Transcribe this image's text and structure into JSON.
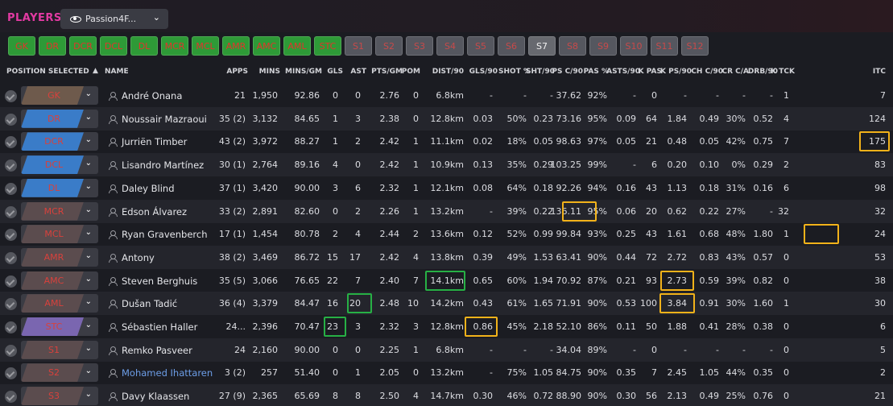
{
  "header": {
    "title": "PLAYERS",
    "view_label": "Passion4F..."
  },
  "positions": [
    {
      "label": "GK",
      "state": "on",
      "w": 34
    },
    {
      "label": "DR",
      "state": "on",
      "w": 34
    },
    {
      "label": "DCR",
      "state": "on",
      "w": 34
    },
    {
      "label": "DCL",
      "state": "on",
      "w": 34
    },
    {
      "label": "DL",
      "state": "on",
      "w": 34
    },
    {
      "label": "MCR",
      "state": "on",
      "w": 34
    },
    {
      "label": "MCL",
      "state": "on",
      "w": 34
    },
    {
      "label": "AMR",
      "state": "on",
      "w": 34
    },
    {
      "label": "AMC",
      "state": "on",
      "w": 34
    },
    {
      "label": "AML",
      "state": "on",
      "w": 34
    },
    {
      "label": "STC",
      "state": "on",
      "w": 34
    },
    {
      "label": "S1",
      "state": "off",
      "w": 34
    },
    {
      "label": "S2",
      "state": "off",
      "w": 34
    },
    {
      "label": "S3",
      "state": "off",
      "w": 34
    },
    {
      "label": "S4",
      "state": "off",
      "w": 34
    },
    {
      "label": "S5",
      "state": "off",
      "w": 34
    },
    {
      "label": "S6",
      "state": "off",
      "w": 34
    },
    {
      "label": "S7",
      "state": "sel",
      "w": 34
    },
    {
      "label": "S8",
      "state": "off",
      "w": 34
    },
    {
      "label": "S9",
      "state": "off",
      "w": 34
    },
    {
      "label": "S10",
      "state": "off",
      "w": 34
    },
    {
      "label": "S11",
      "state": "off",
      "w": 34
    },
    {
      "label": "S12",
      "state": "off",
      "w": 34
    }
  ],
  "columns": [
    "POSITION SELECTED",
    "NAME",
    "APPS",
    "MINS",
    "MINS/GM",
    "GLS",
    "AST",
    "PTS/GM",
    "POM",
    "DIST/90",
    "GLS/90",
    "SHOT %",
    "SHT/90",
    "PS C/90",
    "PAS %",
    "ASTS/90",
    "K PAS",
    "K PS/90",
    "CH C/90",
    "CR C/A",
    "DRB/90",
    "K TCK",
    "ITC"
  ],
  "sort_indicator": "▲",
  "players": [
    {
      "pos": "GK",
      "pos_color": "#6e5a4c",
      "name": "André Onana",
      "link": false,
      "v": [
        "21",
        "1,950",
        "92.86",
        "0",
        "0",
        "2.76",
        "0",
        "6.8km",
        "-",
        "-",
        "-",
        "37.62",
        "92%",
        "-",
        "0",
        "-",
        "-",
        "-",
        "-",
        "1",
        "7"
      ]
    },
    {
      "pos": "DR",
      "pos_color": "#3a7cc8",
      "name": "Noussair Mazraoui",
      "link": false,
      "v": [
        "35 (2)",
        "3,132",
        "84.65",
        "1",
        "3",
        "2.38",
        "0",
        "12.8km",
        "0.03",
        "50%",
        "0.23",
        "73.16",
        "95%",
        "0.09",
        "64",
        "1.84",
        "0.49",
        "30%",
        "0.52",
        "4",
        "124"
      ]
    },
    {
      "pos": "DCR",
      "pos_color": "#3a7cc8",
      "name": "Jurriën Timber",
      "link": false,
      "v": [
        "43 (2)",
        "3,972",
        "88.27",
        "1",
        "2",
        "2.42",
        "1",
        "11.1km",
        "0.02",
        "18%",
        "0.05",
        "98.63",
        "97%",
        "0.05",
        "21",
        "0.48",
        "0.05",
        "42%",
        "0.75",
        "7",
        "175"
      ]
    },
    {
      "pos": "DCL",
      "pos_color": "#3a7cc8",
      "name": "Lisandro Martínez",
      "link": false,
      "v": [
        "30 (1)",
        "2,764",
        "89.16",
        "4",
        "0",
        "2.42",
        "1",
        "10.9km",
        "0.13",
        "35%",
        "0.29",
        "103.25",
        "99%",
        "-",
        "6",
        "0.20",
        "0.10",
        "0%",
        "0.29",
        "2",
        "83"
      ]
    },
    {
      "pos": "DL",
      "pos_color": "#3a7cc8",
      "name": "Daley Blind",
      "link": false,
      "v": [
        "37 (1)",
        "3,420",
        "90.00",
        "3",
        "6",
        "2.32",
        "1",
        "12.1km",
        "0.08",
        "64%",
        "0.18",
        "92.26",
        "94%",
        "0.16",
        "43",
        "1.13",
        "0.18",
        "31%",
        "0.16",
        "6",
        "98"
      ]
    },
    {
      "pos": "MCR",
      "pos_color": "#5b4c4e",
      "name": "Edson Álvarez",
      "link": false,
      "v": [
        "33 (2)",
        "2,891",
        "82.60",
        "0",
        "2",
        "2.26",
        "1",
        "13.2km",
        "-",
        "39%",
        "0.22",
        "136.11",
        "95%",
        "0.06",
        "20",
        "0.62",
        "0.22",
        "27%",
        "-",
        "32",
        "32"
      ]
    },
    {
      "pos": "MCL",
      "pos_color": "#5b4c4e",
      "name": "Ryan Gravenberch",
      "link": false,
      "v": [
        "17 (1)",
        "1,454",
        "80.78",
        "2",
        "4",
        "2.44",
        "2",
        "13.6km",
        "0.12",
        "52%",
        "0.99",
        "99.84",
        "93%",
        "0.25",
        "43",
        "1.61",
        "0.68",
        "48%",
        "1.80",
        "1",
        "24"
      ]
    },
    {
      "pos": "AMR",
      "pos_color": "#5b4c4e",
      "name": "Antony",
      "link": false,
      "v": [
        "38 (2)",
        "3,469",
        "86.72",
        "15",
        "17",
        "2.42",
        "4",
        "13.8km",
        "0.39",
        "49%",
        "1.53",
        "63.41",
        "90%",
        "0.44",
        "72",
        "2.72",
        "0.83",
        "43%",
        "0.57",
        "0",
        "53"
      ]
    },
    {
      "pos": "AMC",
      "pos_color": "#5b4c4e",
      "name": "Steven Berghuis",
      "link": false,
      "v": [
        "35 (5)",
        "3,066",
        "76.65",
        "22",
        "7",
        "2.40",
        "7",
        "14.1km",
        "0.65",
        "60%",
        "1.94",
        "70.92",
        "87%",
        "0.21",
        "93",
        "2.73",
        "0.59",
        "39%",
        "0.82",
        "0",
        "38"
      ]
    },
    {
      "pos": "AML",
      "pos_color": "#5b4c4e",
      "name": "Dušan Tadić",
      "link": false,
      "v": [
        "36 (4)",
        "3,379",
        "84.47",
        "16",
        "20",
        "2.48",
        "10",
        "14.2km",
        "0.43",
        "61%",
        "1.65",
        "71.91",
        "90%",
        "0.53",
        "100",
        "3.84",
        "0.91",
        "30%",
        "1.60",
        "1",
        "30"
      ]
    },
    {
      "pos": "STC",
      "pos_color": "#7a66b0",
      "name": "Sébastien Haller",
      "link": false,
      "v": [
        "24...",
        "2,396",
        "70.47",
        "23",
        "3",
        "2.32",
        "3",
        "12.8km",
        "0.86",
        "45%",
        "2.18",
        "52.10",
        "86%",
        "0.11",
        "50",
        "1.88",
        "0.41",
        "28%",
        "0.38",
        "0",
        "6"
      ]
    },
    {
      "pos": "S1",
      "pos_color": "#5b4c4e",
      "name": "Remko Pasveer",
      "link": false,
      "v": [
        "24",
        "2,160",
        "90.00",
        "0",
        "0",
        "2.25",
        "1",
        "6.8km",
        "-",
        "-",
        "-",
        "34.04",
        "89%",
        "-",
        "0",
        "-",
        "-",
        "-",
        "-",
        "0",
        "5"
      ]
    },
    {
      "pos": "S2",
      "pos_color": "#5b4c4e",
      "name": "Mohamed Ihattaren",
      "link": true,
      "v": [
        "3 (2)",
        "257",
        "51.40",
        "0",
        "1",
        "2.05",
        "0",
        "13.2km",
        "-",
        "75%",
        "1.05",
        "84.75",
        "90%",
        "0.35",
        "7",
        "2.45",
        "1.05",
        "44%",
        "0.35",
        "0",
        "2"
      ]
    },
    {
      "pos": "S3",
      "pos_color": "#5b4c4e",
      "name": "Davy Klaassen",
      "link": false,
      "v": [
        "27 (9)",
        "2,365",
        "65.69",
        "8",
        "8",
        "2.50",
        "4",
        "14.7km",
        "0.30",
        "46%",
        "0.72",
        "88.90",
        "90%",
        "0.30",
        "56",
        "2.13",
        "0.49",
        "25%",
        "0.76",
        "0",
        "21"
      ]
    }
  ],
  "colors": {
    "highlight_gold": "#f2b21a",
    "highlight_green": "#27b045"
  }
}
